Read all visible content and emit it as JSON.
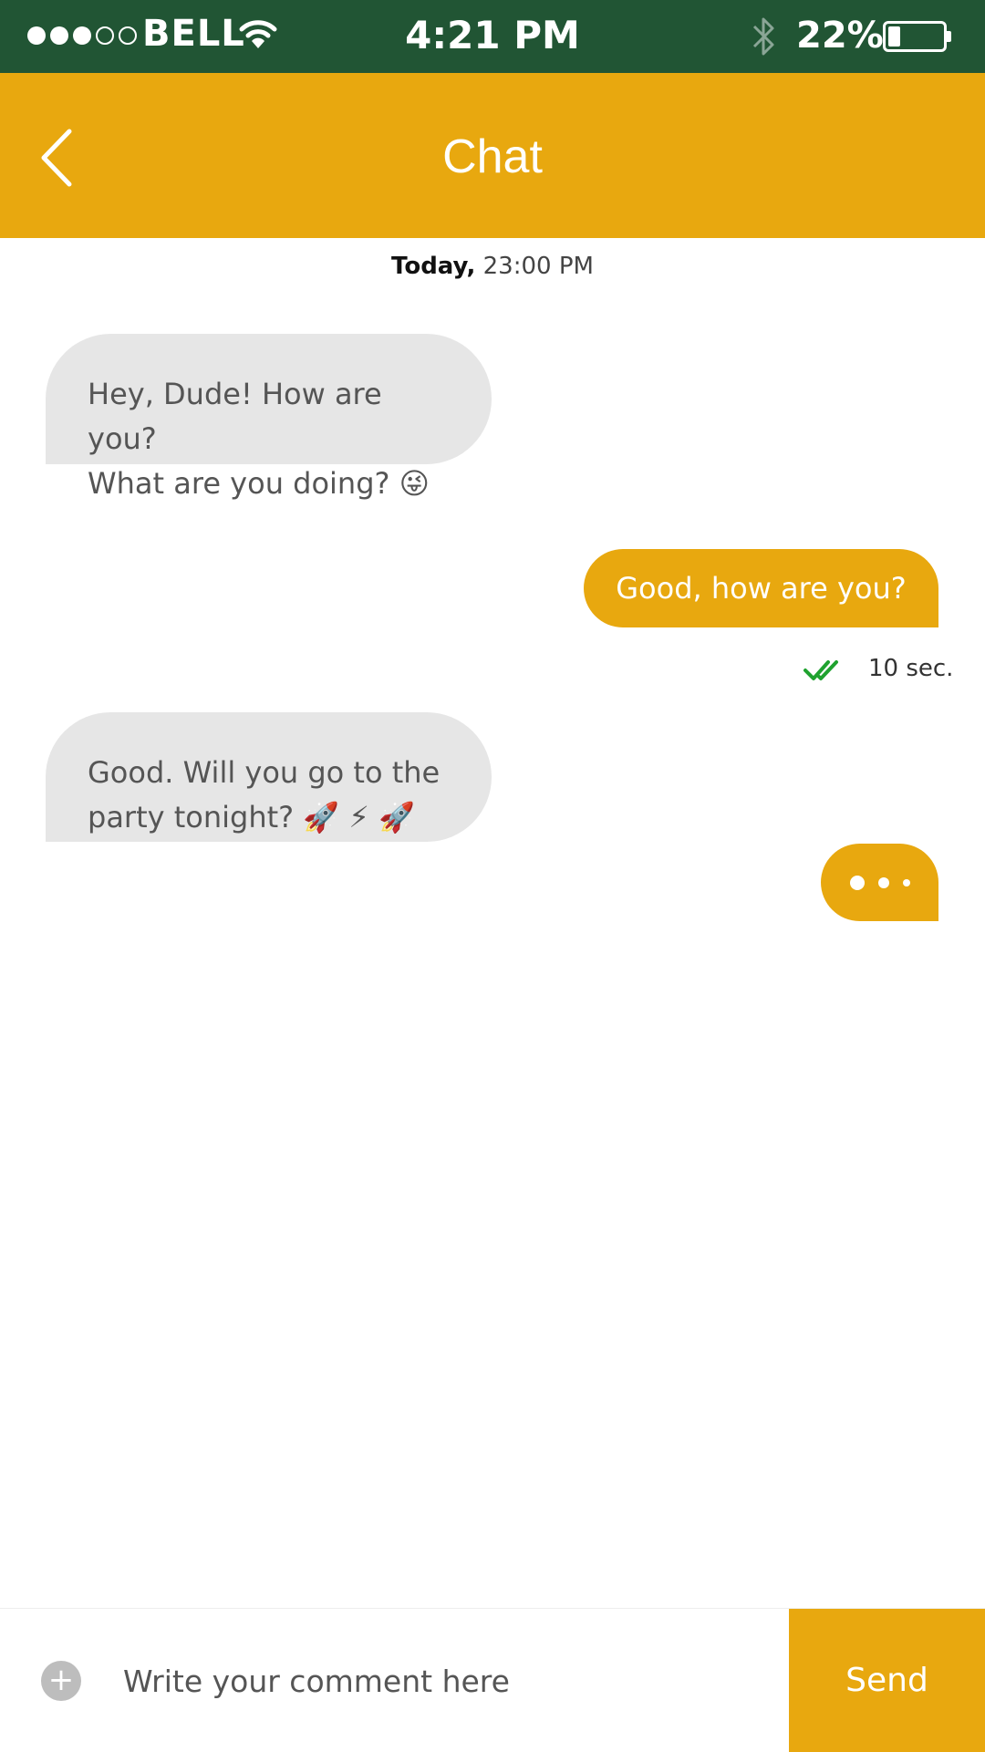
{
  "status_bar": {
    "signal_dots": [
      "full",
      "full",
      "full",
      "empty",
      "empty"
    ],
    "carrier": "BELL",
    "time": "4:21 PM",
    "battery_percent": "22%",
    "battery_level": 0.22,
    "icons": [
      "wifi-icon",
      "bluetooth-icon",
      "battery-icon"
    ]
  },
  "header": {
    "title": "Chat",
    "back_icon": "chevron-left-icon"
  },
  "chat": {
    "date_day": "Today,",
    "date_time": " 23:00 PM",
    "messages": [
      {
        "direction": "incoming",
        "lines": [
          "Hey, Dude! How are you?",
          "What are you doing? 😜"
        ]
      },
      {
        "direction": "outgoing",
        "text": "Good, how are you?",
        "receipt_icon": "double-check-icon",
        "time": "10 sec."
      },
      {
        "direction": "incoming",
        "lines": [
          "Good. Will you go to the",
          "party tonight? 🚀 ⚡ 🚀"
        ]
      }
    ],
    "typing_indicator": true
  },
  "composer": {
    "add_icon": "plus-icon",
    "add_label": "+",
    "placeholder": "Write your comment here",
    "value": "",
    "send_label": "Send"
  },
  "colors": {
    "status_bar": "#215534",
    "accent": "#e8a80f",
    "incoming_bubble": "#e6e6e6",
    "incoming_text": "#555555",
    "receipt_check": "#1fa22f"
  }
}
